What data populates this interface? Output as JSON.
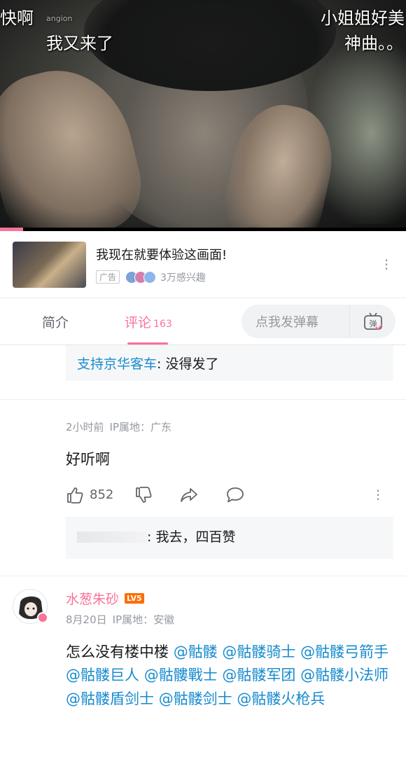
{
  "video": {
    "danmaku": [
      {
        "text": "快啊"
      },
      {
        "text": "angion"
      },
      {
        "text": "我又来了"
      },
      {
        "text": "小姐姐好美"
      },
      {
        "text": "神曲。。"
      }
    ],
    "progress": 0.057
  },
  "ad": {
    "title": "我现在就要体验这画面!",
    "badge": "广告",
    "interest": "3万感兴趣"
  },
  "tabs": {
    "intro": "简介",
    "comments": "评论",
    "comments_count": "163",
    "danmaku_placeholder": "点我发弹幕",
    "danmaku_button": "弹"
  },
  "top_reply": {
    "user": "支持京华客车",
    "text": ": 没得发了"
  },
  "comment1": {
    "time": "2小时前",
    "ip": "IP属地：广东",
    "text": "好听啊",
    "likes": "852",
    "reply_text": ": 我去，四百赞"
  },
  "comment2": {
    "user": "水葱朱砂",
    "level": "LV5",
    "date": "8月20日",
    "ip": "IP属地：安徽",
    "text_prefix": "怎么没有楼中楼 ",
    "mentions": [
      "@骷髅",
      "@骷髅骑士",
      "@骷髅弓箭手",
      "@骷髅巨人",
      "@骷髏戰士",
      "@骷髅军团",
      "@骷髅小法师",
      "@骷髅盾剑士",
      "@骷髅剑士",
      "@骷髅火枪兵"
    ]
  },
  "colors": {
    "accent": "#fb7299",
    "link": "#178bcf",
    "muted": "#9499a0"
  }
}
